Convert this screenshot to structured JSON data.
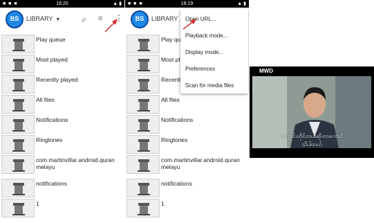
{
  "panels": [
    {
      "status": {
        "left": "■ ■ ■",
        "time": "16:20",
        "right": "▲ ▮"
      },
      "logo": "BS",
      "library": "LIBRARY",
      "items": [
        "Play queue",
        "Most played",
        "Recently played",
        "All files",
        "Notifications",
        "Ringtones",
        "com.martinvillar.android.quranmelayu",
        "notifications",
        "1"
      ]
    },
    {
      "status": {
        "left": "■ ■ ■",
        "time": "16:19",
        "right": "▲ ▮"
      },
      "logo": "BS",
      "library": "LIBRARY",
      "items": [
        "Play queue",
        "Most played",
        "Recently played",
        "All files",
        "Notifications",
        "Ringtones",
        "com.martinvillar.android.quranmelayu",
        "notifications",
        "1"
      ],
      "menu": [
        "Open URL...",
        "Playback mode...",
        "Display mode...",
        "Preferences",
        "Scan for media files"
      ]
    }
  ],
  "video": {
    "watermark": "MWD",
    "subtitle_line1": "ကျောင်းတိုင်တယ်ဆိုတာကောင်",
    "subtitle_line2": "သိပါတယ်"
  },
  "colors": {
    "annotation_arrow": "#d32f2f",
    "logo_blue": "#1e88e5"
  }
}
